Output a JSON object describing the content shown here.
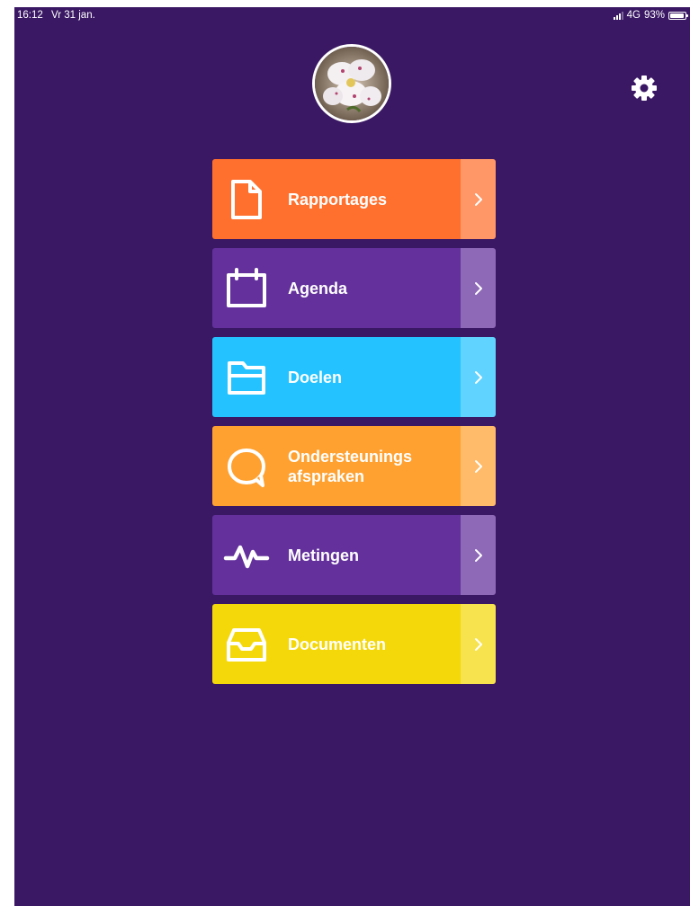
{
  "status_bar": {
    "time": "16:12",
    "date": "Vr 31 jan.",
    "network": "4G",
    "battery": "93%"
  },
  "menu": {
    "items": [
      {
        "label": "Rapportages",
        "icon": "document-icon",
        "color": "#ff6f2d"
      },
      {
        "label": "Agenda",
        "icon": "calendar-icon",
        "color": "#63309c"
      },
      {
        "label": "Doelen",
        "icon": "folder-icon",
        "color": "#24c3ff"
      },
      {
        "label": "Ondersteunings afspraken",
        "icon": "chat-bubble-icon",
        "color": "#ffa130"
      },
      {
        "label": "Metingen",
        "icon": "heartbeat-icon",
        "color": "#63309c"
      },
      {
        "label": "Documenten",
        "icon": "inbox-tray-icon",
        "color": "#f4d80a"
      }
    ]
  },
  "colors": {
    "background": "#3a1864",
    "text": "#ffffff"
  }
}
